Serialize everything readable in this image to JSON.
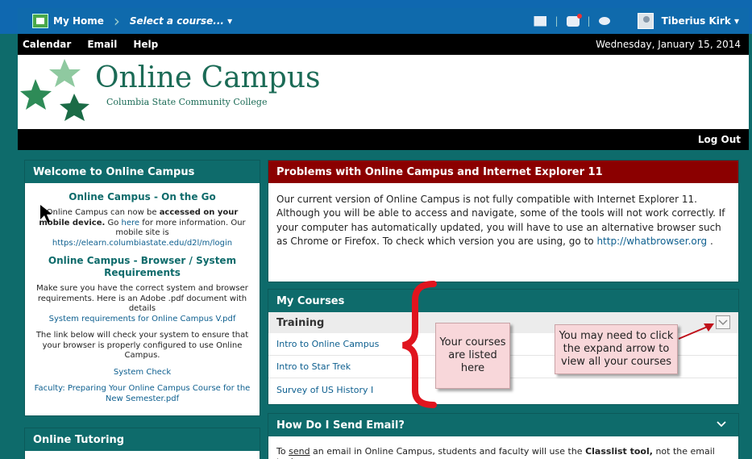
{
  "topnav": {
    "home": "My Home",
    "course_select": "Select a course...",
    "user": "Tiberius Kirk"
  },
  "menubar": {
    "items": [
      "Calendar",
      "Email",
      "Help"
    ],
    "date": "Wednesday, January 15, 2014"
  },
  "banner": {
    "title": "Online Campus",
    "subtitle": "Columbia State Community College"
  },
  "logout": "Log Out",
  "welcome": {
    "title": "Welcome to Online Campus",
    "go_heading": "Online Campus - On the Go",
    "go_text1": "Online Campus can now be",
    "go_bold": "accessed on your mobile device.",
    "go_text2": "Go",
    "go_here": "here",
    "go_text3": "for more information. Our mobile site is",
    "mobile_url": "https://elearn.columbiastate.edu/d2l/m/login",
    "req_heading": "Online Campus - Browser / System Requirements",
    "req_text": "Make sure you have the correct system and browser requirements. Here is an Adobe .pdf document with details",
    "req_link": "System requirements for Online Campus V.pdf",
    "check_text": "The link below will check your system to ensure that your browser is properly configured to use Online Campus.",
    "check_link": "System Check",
    "faculty_link": "Faculty: Preparing Your Online Campus Course for the New Semester.pdf"
  },
  "tutoring": {
    "title": "Online Tutoring"
  },
  "alert": {
    "title": "Problems with Online Campus and Internet Explorer 11",
    "body": "Our current version of Online Campus is not fully compatible with Internet Explorer 11. Although you will be able to access and navigate, some of the tools will not work correctly. If your computer has automatically updated, you will have to use an alternative browser such as Chrome or Firefox.  To check which version you are using, go to",
    "link": "http://whatbrowser.org",
    "end": "."
  },
  "courses": {
    "title": "My Courses",
    "group": "Training",
    "items": [
      "Intro to Online Campus",
      "Intro to Star Trek",
      "Survey of US History I"
    ]
  },
  "email": {
    "title": "How Do I Send Email?",
    "body_pre": "To",
    "body_send": "send",
    "body_mid": "an email in Online Campus, students and faculty will use the",
    "body_bold": "Classlist tool,",
    "body_end": "not the email tool."
  },
  "callouts": {
    "listed": "Your courses are listed here",
    "expand": "You may need to click the expand arrow to view all your courses"
  }
}
